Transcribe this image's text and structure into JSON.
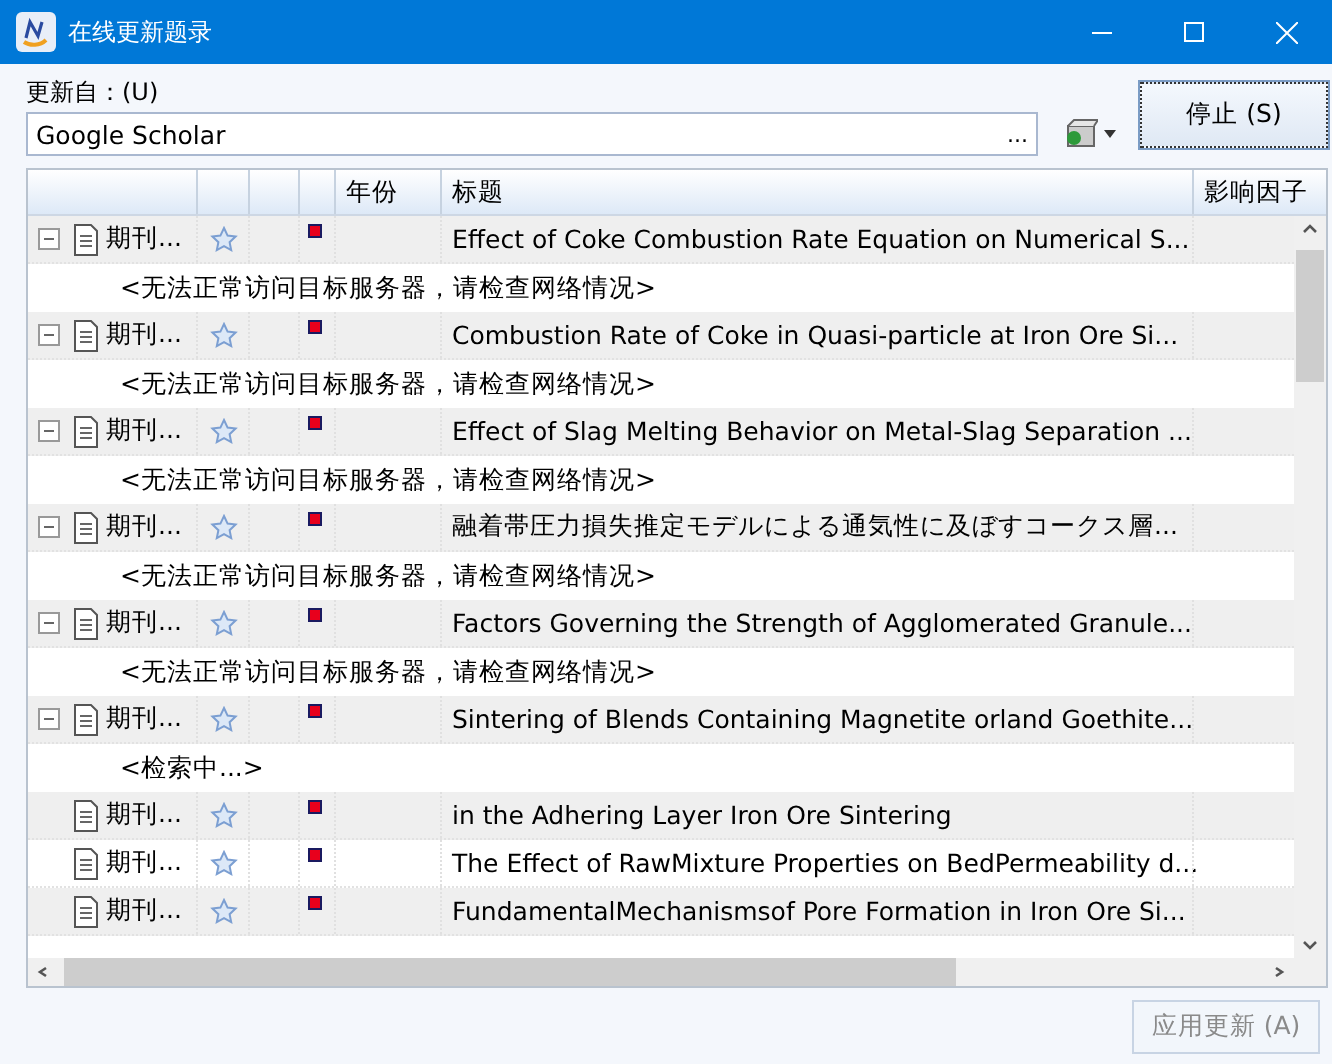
{
  "window": {
    "title": "在线更新题录"
  },
  "source": {
    "label": "更新自：(U)",
    "value": "Google Scholar",
    "browse": "..."
  },
  "stop_button": "停止 (S)",
  "table": {
    "columns": [
      "",
      "",
      "",
      "",
      "年份",
      "标题",
      "影响因子"
    ],
    "rows": [
      {
        "type": "期刊...",
        "title": "Effect of Coke Combustion Rate Equation on Numerical S...",
        "expanded": true,
        "children": [
          {
            "text": "<无法正常访问目标服务器，请检查网络情况>"
          }
        ]
      },
      {
        "type": "期刊...",
        "title": "Combustion Rate of Coke in Quasi-particle at Iron Ore Si...",
        "expanded": true,
        "children": [
          {
            "text": "<无法正常访问目标服务器，请检查网络情况>"
          }
        ]
      },
      {
        "type": "期刊...",
        "title": "Effect of Slag Melting Behavior on Metal-Slag Separation ...",
        "expanded": true,
        "children": [
          {
            "text": "<无法正常访问目标服务器，请检查网络情况>"
          }
        ]
      },
      {
        "type": "期刊...",
        "title": "融着帯圧力損失推定モデルによる通気性に及ぼすコークス層...",
        "expanded": true,
        "children": [
          {
            "text": "<无法正常访问目标服务器，请检查网络情况>"
          }
        ]
      },
      {
        "type": "期刊...",
        "title": "Factors Governing the Strength of Agglomerated Granule...",
        "expanded": true,
        "children": [
          {
            "text": "<无法正常访问目标服务器，请检查网络情况>"
          }
        ]
      },
      {
        "type": "期刊...",
        "title": "Sintering of Blends Containing Magnetite orland Goethite...",
        "expanded": true,
        "children": [
          {
            "text": "<检索中...>"
          }
        ]
      },
      {
        "type": "期刊...",
        "title": "in the Adhering Layer Iron Ore Sintering"
      },
      {
        "type": "期刊...",
        "title": "The Effect of RawMixture Properties on BedPermeability d..."
      },
      {
        "type": "期刊...",
        "title": "FundamentalMechanismsof Pore Formation in Iron Ore Si..."
      }
    ]
  },
  "apply_button": {
    "label": "应用更新 (A)",
    "disabled": true
  }
}
